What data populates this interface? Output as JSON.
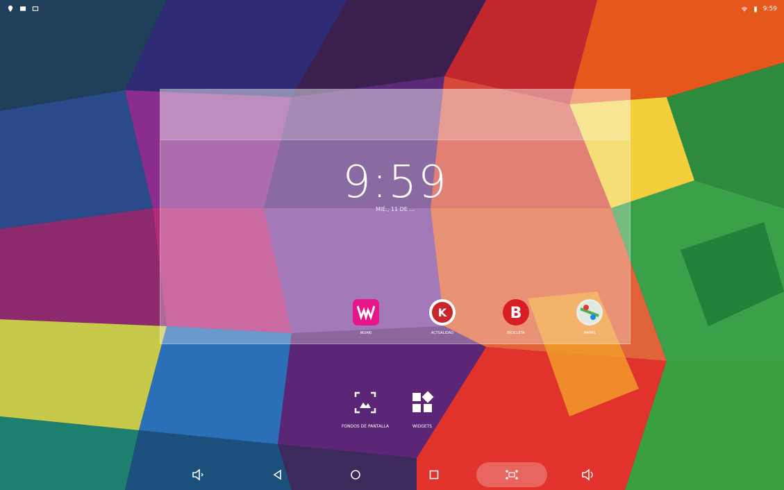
{
  "status_bar": {
    "left_icons": [
      "location-icon",
      "image-icon",
      "screen-icon"
    ],
    "right_icons": [
      "wifi-icon",
      "battery-icon"
    ],
    "time": "9:59"
  },
  "clock_widget": {
    "time": "9:59",
    "date": "MIÉ., 11 DE ..."
  },
  "home_apps": [
    {
      "name": "wuaki",
      "label": "WUAKI",
      "icon": "wuaki-icon",
      "color": "#e7168a"
    },
    {
      "name": "actualidad",
      "label": "ACTUALIDAD",
      "icon": "kiosko-icon",
      "color": "#c9262c"
    },
    {
      "name": "bicicleta",
      "label": "BICICLETA",
      "icon": "b-icon",
      "color": "#d61e24"
    },
    {
      "name": "mapas",
      "label": "MAPAS",
      "icon": "maps-icon",
      "color": "#4caf50"
    }
  ],
  "bottom_options": [
    {
      "name": "wallpapers",
      "label": "FONDOS DE PANTALLA",
      "icon": "wallpaper-icon"
    },
    {
      "name": "widgets",
      "label": "WIDGETS",
      "icon": "widgets-icon"
    }
  ],
  "nav_bar": {
    "buttons": [
      "volume-down-icon",
      "back-icon",
      "home-icon",
      "recents-icon",
      "screenshot-icon",
      "volume-up-icon"
    ]
  },
  "colors": {
    "overlay": "#ffffff",
    "text": "#ffffff"
  }
}
